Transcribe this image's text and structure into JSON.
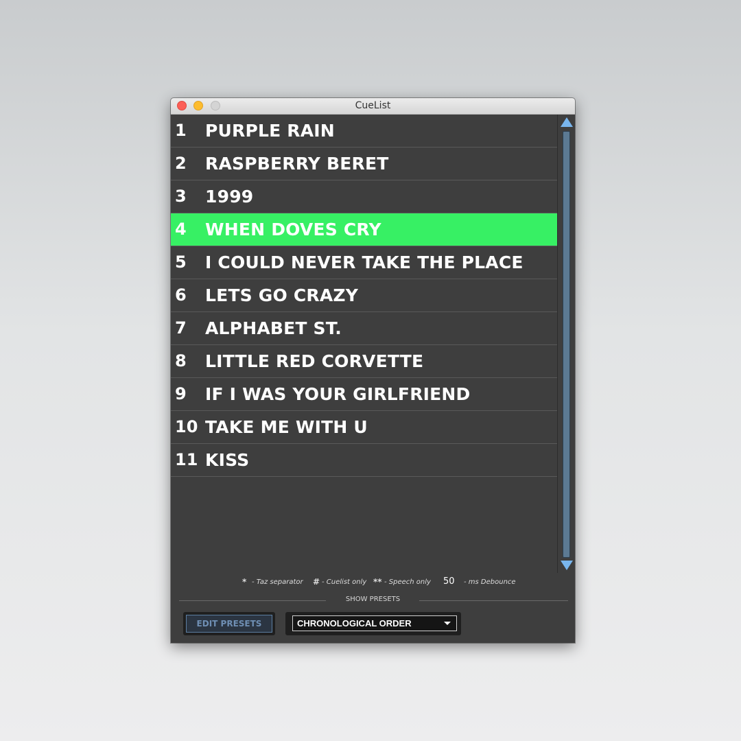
{
  "window": {
    "title": "CueList"
  },
  "cues": [
    {
      "num": "1",
      "name": "PURPLE RAIN",
      "selected": false
    },
    {
      "num": "2",
      "name": "RASPBERRY BERET",
      "selected": false
    },
    {
      "num": "3",
      "name": "1999",
      "selected": false
    },
    {
      "num": "4",
      "name": "WHEN DOVES CRY",
      "selected": true
    },
    {
      "num": "5",
      "name": "I COULD NEVER TAKE THE PLACE",
      "selected": false
    },
    {
      "num": "6",
      "name": "LETS GO CRAZY",
      "selected": false
    },
    {
      "num": "7",
      "name": "ALPHABET ST.",
      "selected": false
    },
    {
      "num": "8",
      "name": "LITTLE RED CORVETTE",
      "selected": false
    },
    {
      "num": "9",
      "name": "IF I WAS YOUR GIRLFRIEND",
      "selected": false
    },
    {
      "num": "10",
      "name": "TAKE ME WITH U",
      "selected": false
    },
    {
      "num": "11",
      "name": "KISS",
      "selected": false
    }
  ],
  "legend": {
    "sym1": "*",
    "txt1": "- Taz separator",
    "sym2": "#",
    "txt2": "- Cuelist only",
    "sym3": "**",
    "txt3": "- Speech only",
    "debounce_value": "50",
    "debounce_label": "- ms Debounce"
  },
  "presets": {
    "section_label": "SHOW PRESETS",
    "edit_label": "EDIT PRESETS",
    "order_selected": "CHRONOLOGICAL ORDER"
  },
  "colors": {
    "selected_row": "#37f064",
    "list_bg": "#3e3e3e",
    "scroll_arrow": "#79b6ee"
  }
}
